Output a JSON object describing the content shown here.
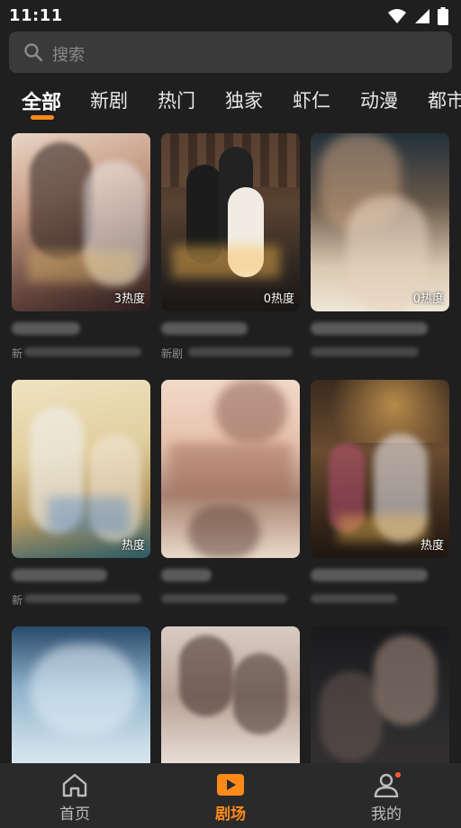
{
  "status_bar": {
    "time": "11:11"
  },
  "search": {
    "placeholder": "搜索"
  },
  "tabs": [
    "全部",
    "新剧",
    "热门",
    "独家",
    "虾仁",
    "动漫",
    "都市"
  ],
  "cards": [
    {
      "heat": "3热度",
      "title": "",
      "sub": "新"
    },
    {
      "heat": "0热度",
      "title": "",
      "sub": "新剧"
    },
    {
      "heat": "0热度",
      "title": "",
      "sub": ""
    },
    {
      "heat": "热度",
      "title": "",
      "sub": "新"
    },
    {
      "heat": "",
      "title": "",
      "sub": ""
    },
    {
      "heat": "热度",
      "title": "",
      "sub": ""
    },
    {
      "heat": "",
      "title": "",
      "sub": ""
    },
    {
      "heat": "",
      "title": "",
      "sub": ""
    },
    {
      "heat": "",
      "title": "",
      "sub": ""
    }
  ],
  "bottom_nav": [
    {
      "label": "首页",
      "icon": "home-icon"
    },
    {
      "label": "剧场",
      "icon": "play-icon"
    },
    {
      "label": "我的",
      "icon": "user-icon"
    }
  ],
  "colors": {
    "accent": "#ff8a1a",
    "background": "#1f1f1f",
    "search_bg": "#3a3a3a"
  }
}
